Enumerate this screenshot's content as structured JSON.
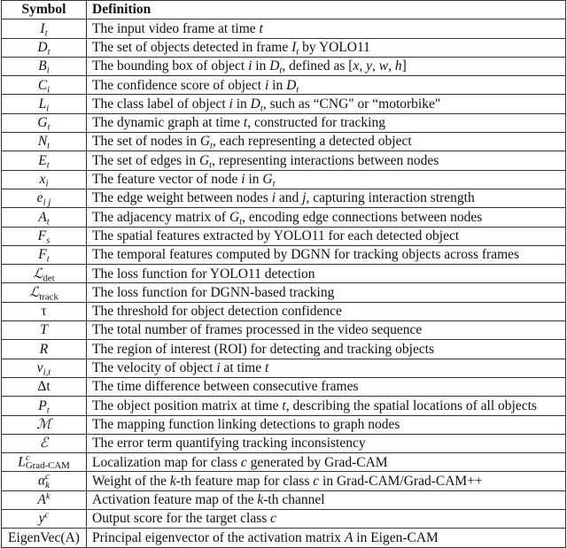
{
  "table": {
    "headers": {
      "symbol": "Symbol",
      "definition": "Definition"
    },
    "rows": [
      {
        "symbol": {
          "base": "I",
          "sub": "t",
          "sup": ""
        },
        "definition": "The input video frame at time t"
      },
      {
        "symbol": {
          "base": "D",
          "sub": "t",
          "sup": ""
        },
        "definition": "The set of objects detected in frame I_t by YOLO11"
      },
      {
        "symbol": {
          "base": "B",
          "sub": "i",
          "sup": ""
        },
        "definition": "The bounding box of object i in D_t, defined as [x, y, w, h]"
      },
      {
        "symbol": {
          "base": "C",
          "sub": "i",
          "sup": ""
        },
        "definition": "The confidence score of object i in D_t"
      },
      {
        "symbol": {
          "base": "L",
          "sub": "i",
          "sup": ""
        },
        "definition": "The class label of object i in D_t, such as “CNG\" or “motorbike\""
      },
      {
        "symbol": {
          "base": "G",
          "sub": "t",
          "sup": ""
        },
        "definition": "The dynamic graph at time t, constructed for tracking"
      },
      {
        "symbol": {
          "base": "N",
          "sub": "t",
          "sup": ""
        },
        "definition": "The set of nodes in G_t, each representing a detected object"
      },
      {
        "symbol": {
          "base": "E",
          "sub": "t",
          "sup": ""
        },
        "definition": "The set of edges in G_t, representing interactions between nodes"
      },
      {
        "symbol": {
          "base": "x",
          "sub": "i",
          "sup": ""
        },
        "definition": "The feature vector of node i in G_t"
      },
      {
        "symbol": {
          "base": "e",
          "sub": "i j",
          "sup": ""
        },
        "definition": "The edge weight between nodes i and j, capturing interaction strength"
      },
      {
        "symbol": {
          "base": "A",
          "sub": "t",
          "sup": ""
        },
        "definition": "The adjacency matrix of G_t, encoding edge connections between nodes"
      },
      {
        "symbol": {
          "base": "F",
          "sub": "s",
          "sup": ""
        },
        "definition": "The spatial features extracted by YOLO11 for each detected object"
      },
      {
        "symbol": {
          "base": "F",
          "sub": "t",
          "sup": ""
        },
        "definition": "The temporal features computed by DGNN for tracking objects across frames"
      },
      {
        "symbol": {
          "base": "ℒ",
          "sub": "det",
          "sup": ""
        },
        "definition": "The loss function for YOLO11 detection"
      },
      {
        "symbol": {
          "base": "ℒ",
          "sub": "track",
          "sup": ""
        },
        "definition": "The loss function for DGNN-based tracking"
      },
      {
        "symbol": {
          "base": "τ",
          "sub": "",
          "sup": ""
        },
        "definition": "The threshold for object detection confidence"
      },
      {
        "symbol": {
          "base": "T",
          "sub": "",
          "sup": ""
        },
        "definition": "The total number of frames processed in the video sequence"
      },
      {
        "symbol": {
          "base": "R",
          "sub": "",
          "sup": ""
        },
        "definition": "The region of interest (ROI) for detecting and tracking objects"
      },
      {
        "symbol": {
          "base": "v",
          "sub": "i,t",
          "sup": ""
        },
        "definition": "The velocity of object i at time t"
      },
      {
        "symbol": {
          "base": "Δt",
          "sub": "",
          "sup": ""
        },
        "definition": "The time difference between consecutive frames"
      },
      {
        "symbol": {
          "base": "P",
          "sub": "t",
          "sup": ""
        },
        "definition": "The object position matrix at time t, describing the spatial locations of all objects"
      },
      {
        "symbol": {
          "base": "ℳ",
          "sub": "",
          "sup": ""
        },
        "definition": "The mapping function linking detections to graph nodes"
      },
      {
        "symbol": {
          "base": "ℰ",
          "sub": "",
          "sup": ""
        },
        "definition": "The error term quantifying tracking inconsistency"
      },
      {
        "symbol": {
          "base": "L",
          "sub": "Grad-CAM",
          "sup": "c"
        },
        "definition": "Localization map for class c generated by Grad-CAM"
      },
      {
        "symbol": {
          "base": "α",
          "sub": "k",
          "sup": "c"
        },
        "definition": "Weight of the k-th feature map for class c in Grad-CAM/Grad-CAM++"
      },
      {
        "symbol": {
          "base": "A",
          "sub": "",
          "sup": "k"
        },
        "definition": "Activation feature map of the k-th channel"
      },
      {
        "symbol": {
          "base": "y",
          "sub": "",
          "sup": "c"
        },
        "definition": "Output score for the target class c"
      },
      {
        "symbol": {
          "base": "EigenVec(A)",
          "sub": "",
          "sup": ""
        },
        "definition": "Principal eigenvector of the activation matrix A in Eigen-CAM"
      }
    ]
  }
}
